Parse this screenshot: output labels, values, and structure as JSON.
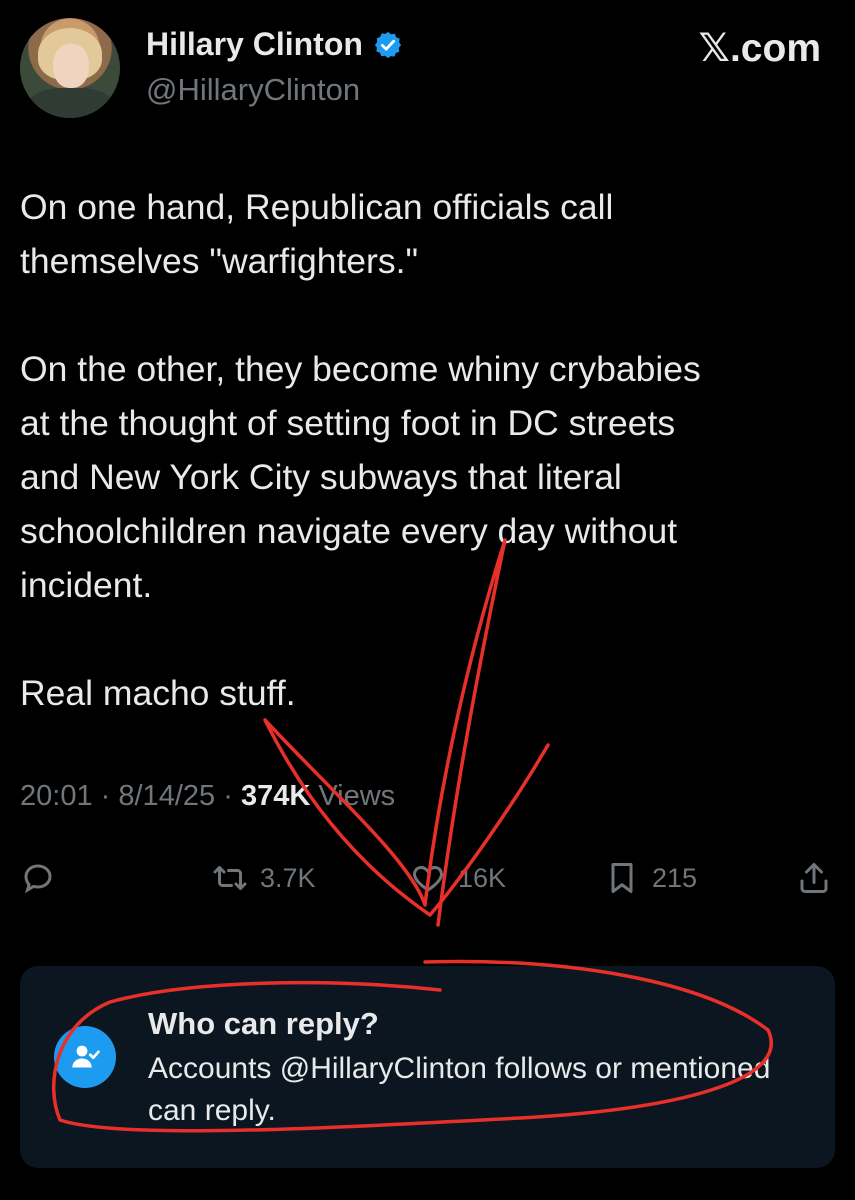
{
  "header": {
    "name": "Hillary Clinton",
    "handle": "@HillaryClinton",
    "site": "𝕏.com",
    "avatar_icon": "profile-photo",
    "verified_icon": "verified-badge-icon",
    "verified_color": "#1d9bf0"
  },
  "tweet": {
    "text": "On one hand, Republican officials call\nthemselves \"warfighters.\"\n\nOn the other, they become whiny crybabies\nat the thought of setting foot in DC streets\nand New York City subways that literal\nschoolchildren navigate every day without\nincident.\n\nReal macho stuff."
  },
  "meta": {
    "time": "20:01",
    "date": "8/14/25",
    "views_count": "374K",
    "views_label": "Views",
    "separator": "·"
  },
  "actions": {
    "reply_icon": "reply-icon",
    "retweet_icon": "retweet-icon",
    "retweets": "3.7K",
    "like_icon": "heart-icon",
    "likes": "16K",
    "bookmark_icon": "bookmark-icon",
    "bookmarks": "215",
    "share_icon": "share-icon"
  },
  "reply_settings": {
    "icon": "people-check-icon",
    "title": "Who can reply?",
    "description": "Accounts @HillaryClinton follows or mentioned can reply."
  },
  "annotation": {
    "color": "#e8302a",
    "shapes": [
      "red-arrow",
      "red-circle"
    ]
  }
}
